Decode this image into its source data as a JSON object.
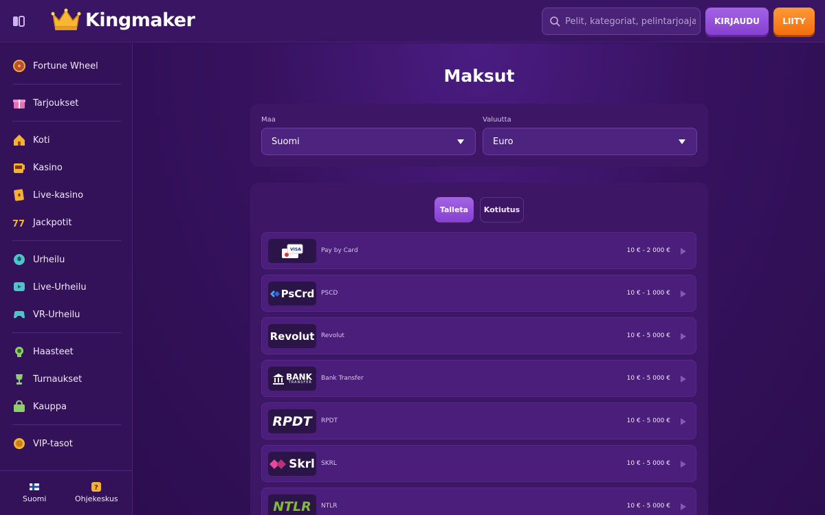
{
  "header": {
    "brand": "Kingmaker",
    "search_placeholder": "Pelit, kategoriat, pelintarjoajat",
    "login_label": "KIRJAUDU",
    "join_label": "LIITY"
  },
  "sidebar": {
    "items": [
      {
        "label": "Fortune Wheel",
        "icon": "fortune-wheel-icon"
      },
      {
        "label": "Tarjoukset",
        "icon": "gift-icon"
      },
      {
        "label": "Koti",
        "icon": "home-icon"
      },
      {
        "label": "Kasino",
        "icon": "slot-machine-icon"
      },
      {
        "label": "Live-kasino",
        "icon": "cards-icon"
      },
      {
        "label": "Jackpotit",
        "icon": "jackpot-777-icon"
      },
      {
        "label": "Urheilu",
        "icon": "football-icon"
      },
      {
        "label": "Live-Urheilu",
        "icon": "live-tv-icon"
      },
      {
        "label": "VR-Urheilu",
        "icon": "gamepad-icon"
      },
      {
        "label": "Haasteet",
        "icon": "medal-icon"
      },
      {
        "label": "Turnaukset",
        "icon": "trophy-icon"
      },
      {
        "label": "Kauppa",
        "icon": "shop-bag-icon"
      },
      {
        "label": "VIP-tasot",
        "icon": "vip-coin-icon"
      }
    ],
    "bottom": {
      "language_label": "Suomi",
      "help_label": "Ohjekeskus"
    }
  },
  "main": {
    "title": "Maksut",
    "country_label": "Maa",
    "country_value": "Suomi",
    "currency_label": "Valuutta",
    "currency_value": "Euro",
    "tabs": [
      {
        "label": "Talleta",
        "active": true
      },
      {
        "label": "Kotiutus",
        "active": false
      }
    ],
    "methods": [
      {
        "name": "Pay by Card",
        "range": "10 € - 2 000 €",
        "logo_text": "VISA"
      },
      {
        "name": "PSCD",
        "range": "10 € - 1 000 €",
        "logo_text": "PsCrd"
      },
      {
        "name": "Revolut",
        "range": "10 € - 5 000 €",
        "logo_text": "Revolut"
      },
      {
        "name": "Bank Transfer",
        "range": "10 € - 5 000 €",
        "logo_text": "BANK",
        "logo_subtext": "TRANSFER"
      },
      {
        "name": "RPDT",
        "range": "10 € - 5 000 €",
        "logo_text": "RPDT"
      },
      {
        "name": "SKRL",
        "range": "10 € - 5 000 €",
        "logo_text": "Skrl"
      },
      {
        "name": "NTLR",
        "range": "10 € - 5 000 €",
        "logo_text": "NTLR"
      }
    ]
  },
  "colors": {
    "accent_purple": "#9352dc",
    "accent_orange": "#f7811f",
    "background": "#2b0f4d"
  }
}
